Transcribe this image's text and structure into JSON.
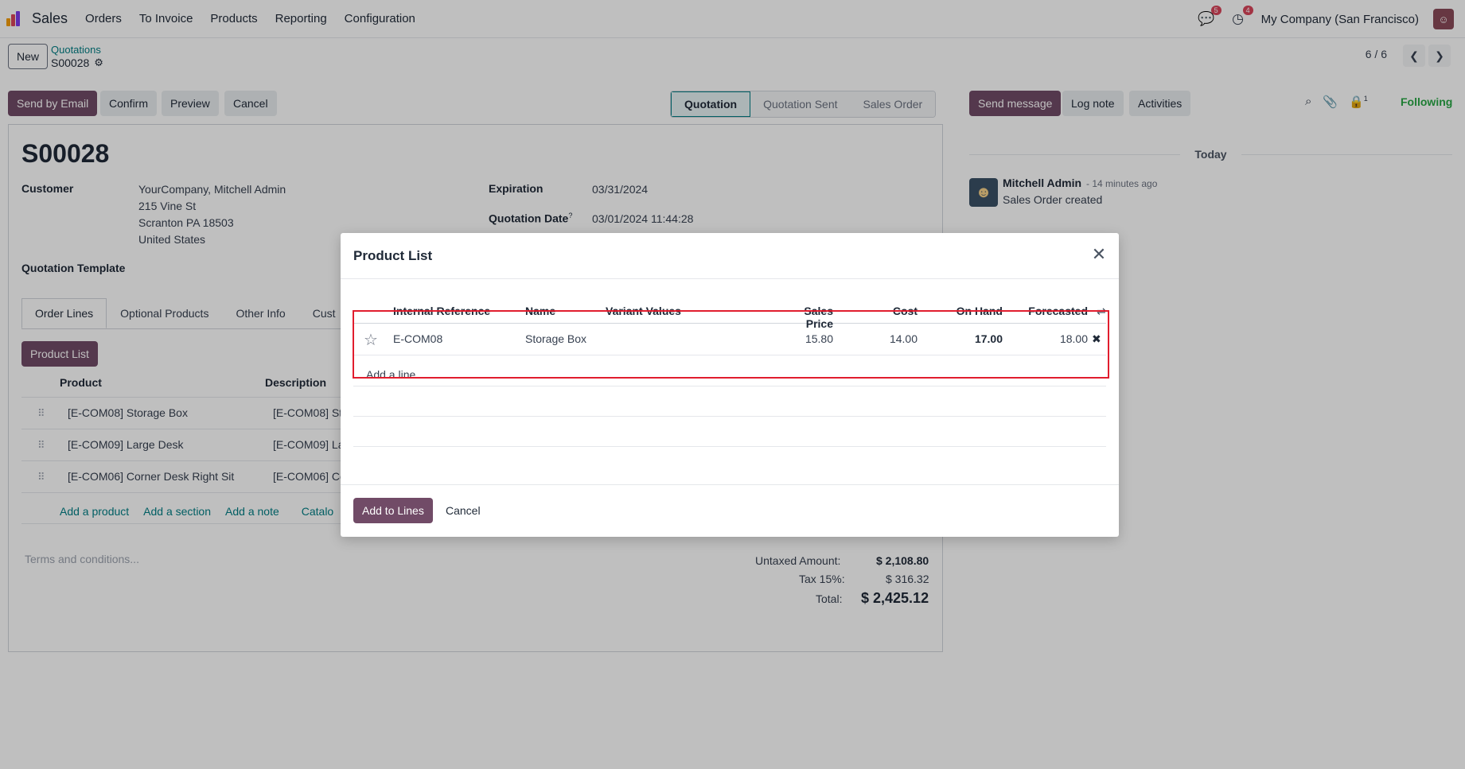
{
  "navbar": {
    "app_name": "Sales",
    "menu": [
      "Orders",
      "To Invoice",
      "Products",
      "Reporting",
      "Configuration"
    ],
    "messages_count": "5",
    "activities_count": "4",
    "company": "My Company (San Francisco)"
  },
  "control": {
    "new_label": "New",
    "breadcrumb_parent": "Quotations",
    "breadcrumb_current": "S00028",
    "pager": "6 / 6"
  },
  "actions": {
    "send_email": "Send by Email",
    "confirm": "Confirm",
    "preview": "Preview",
    "cancel": "Cancel",
    "status_steps": [
      "Quotation",
      "Quotation Sent",
      "Sales Order"
    ],
    "active_status": "Quotation",
    "send_message": "Send message",
    "log_note": "Log note",
    "activities": "Activities",
    "followers_count": "1",
    "following": "Following"
  },
  "form": {
    "title": "S00028",
    "customer_label": "Customer",
    "customer_lines": [
      "YourCompany, Mitchell Admin",
      "215 Vine St",
      "Scranton PA 18503",
      "United States"
    ],
    "expiration_label": "Expiration",
    "expiration": "03/31/2024",
    "quotation_date_label": "Quotation Date",
    "quotation_date_help": "?",
    "quotation_date": "03/01/2024 11:44:28",
    "template_label": "Quotation Template",
    "tabs": [
      "Order Lines",
      "Optional Products",
      "Other Info",
      "Cust"
    ],
    "product_list_button": "Product List",
    "col_product": "Product",
    "col_description": "Description",
    "order_lines": [
      {
        "product": "[E-COM08] Storage Box",
        "description": "[E-COM08] Sto"
      },
      {
        "product": "[E-COM09] Large Desk",
        "description": "[E-COM09] Larg"
      },
      {
        "product": "[E-COM06] Corner Desk Right Sit",
        "description": "[E-COM06] Cor"
      }
    ],
    "add_product": "Add a product",
    "add_section": "Add a section",
    "add_note": "Add a note",
    "catalog": "Catalo",
    "terms_placeholder": "Terms and conditions...",
    "untaxed_label": "Untaxed Amount:",
    "untaxed": "$ 2,108.80",
    "tax_label": "Tax 15%:",
    "tax": "$ 316.32",
    "total_label": "Total:",
    "total": "$ 2,425.12"
  },
  "chatter": {
    "today": "Today",
    "author": "Mitchell Admin",
    "time": "- 14 minutes ago",
    "body": "Sales Order created"
  },
  "modal": {
    "title": "Product List",
    "columns": [
      "Internal Reference",
      "Name",
      "Variant Values",
      "Sales Price",
      "Cost",
      "On Hand",
      "Forecasted"
    ],
    "rows": [
      {
        "ref": "E-COM08",
        "name": "Storage Box",
        "variant": "",
        "price": "15.80",
        "cost": "14.00",
        "on_hand": "17.00",
        "forecasted": "18.00"
      }
    ],
    "add_line": "Add a line",
    "add_to_lines": "Add to Lines",
    "cancel": "Cancel"
  }
}
